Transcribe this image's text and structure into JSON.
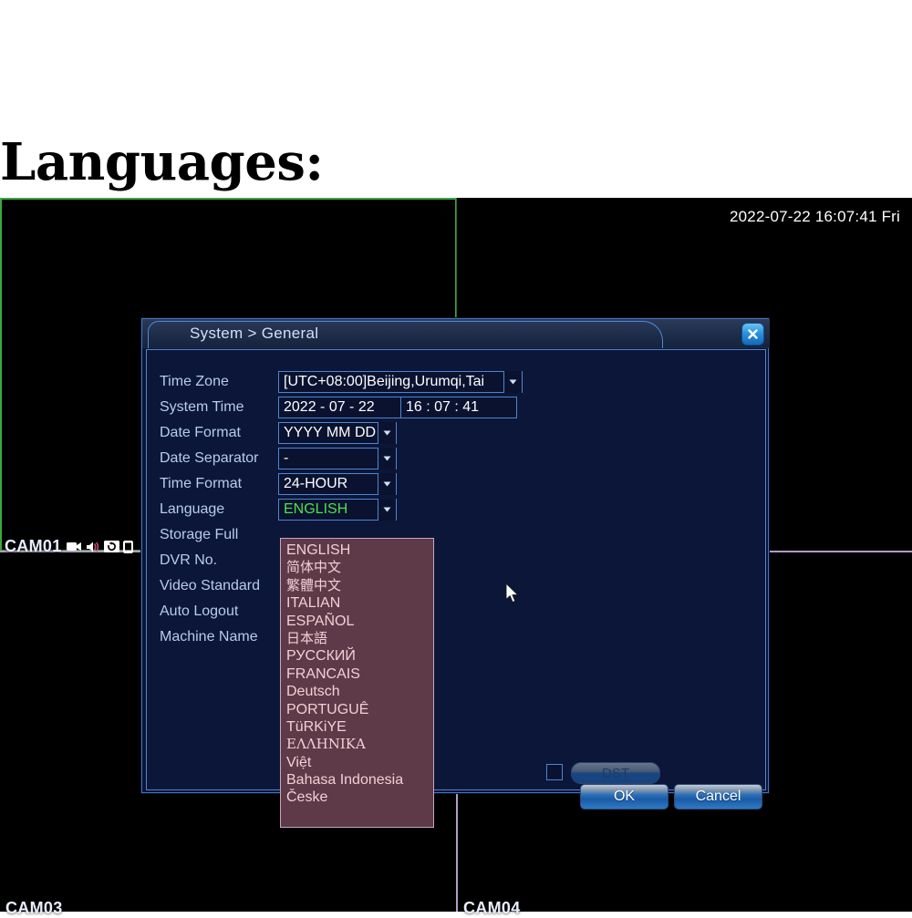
{
  "heading": "Languages:",
  "video_wall": {
    "timestamp": "2022-07-22 16:07:41 Fri",
    "channels": [
      {
        "label": "CAM01",
        "icons": [
          "video-camera-icon",
          "speaker-mute-icon",
          "record-cycle-icon",
          "mobile-device-icon"
        ]
      },
      {
        "label": "CAM03",
        "icons": []
      },
      {
        "label": "CAM04",
        "icons": []
      }
    ]
  },
  "dialog": {
    "title": "System > General",
    "close_label": "Close",
    "fields": {
      "time_zone": {
        "label": "Time Zone",
        "value": "[UTC+08:00]Beijing,Urumqi,Tai"
      },
      "system_time": {
        "label": "System Time",
        "date": "2022 - 07 - 22",
        "clock": "16 : 07 : 41"
      },
      "date_format": {
        "label": "Date Format",
        "value": "YYYY MM DD"
      },
      "date_separator": {
        "label": "Date Separator",
        "value": "-"
      },
      "time_format": {
        "label": "Time Format",
        "value": "24-HOUR"
      },
      "language": {
        "label": "Language",
        "value": "ENGLISH"
      },
      "storage_full": {
        "label": "Storage Full"
      },
      "dvr_no": {
        "label": "DVR No."
      },
      "video_standard": {
        "label": "Video Standard"
      },
      "auto_logout": {
        "label": "Auto Logout"
      },
      "machine_name": {
        "label": "Machine Name"
      }
    },
    "dst": {
      "label": "DST"
    },
    "language_options": [
      "ENGLISH",
      "简体中文",
      "繁體中文",
      "ITALIAN",
      "ESPAÑOL",
      "日本語",
      "РУССКИЙ",
      "FRANCAIS",
      "Deutsch",
      "PORTUGUÊ",
      "TüRKiYE",
      "ΕΛΛΗΝΙΚΑ",
      "Việt",
      "Bahasa Indonesia",
      "Česke"
    ],
    "buttons": {
      "ok": "OK",
      "cancel": "Cancel"
    }
  },
  "colors": {
    "accent_green": "#49e24b",
    "dialog_border": "#4e86cf",
    "dialog_bg": "#0b1638",
    "popup_bg": "#5e3a48",
    "popup_text": "#f0cfd6",
    "selected_channel_border": "#3ba83b",
    "grid_divider": "#b49ac4"
  }
}
